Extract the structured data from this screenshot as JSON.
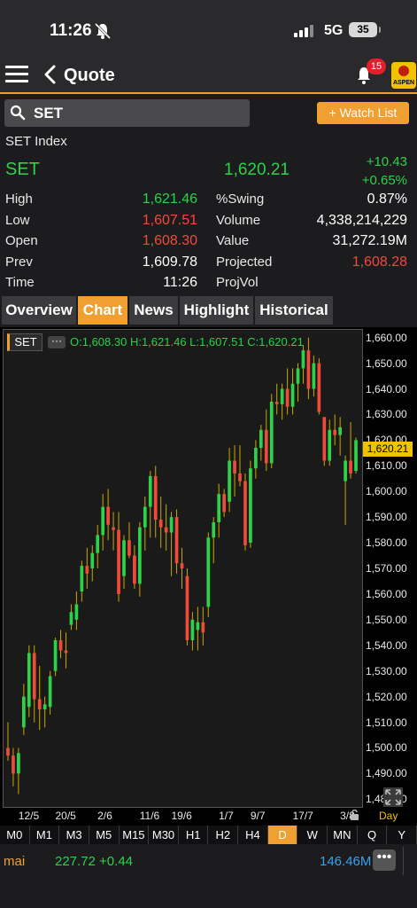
{
  "status_bar": {
    "time": "11:26",
    "network": "5G",
    "battery": "35"
  },
  "nav": {
    "title": "Quote",
    "notification_count": "15",
    "logo_text": "ASPEN"
  },
  "search": {
    "query": "SET",
    "watch_list_label": "+ Watch List"
  },
  "quote": {
    "index_name": "SET Index",
    "symbol": "SET",
    "last": "1,620.21",
    "change": "+10.43",
    "change_pct": "+0.65%",
    "stats_left": [
      {
        "label": "High",
        "value": "1,621.46",
        "color": "#2bd24a"
      },
      {
        "label": "Low",
        "value": "1,607.51",
        "color": "#f04a3a"
      },
      {
        "label": "Open",
        "value": "1,608.30",
        "color": "#f04a3a"
      },
      {
        "label": "Prev",
        "value": "1,609.78",
        "color": "#ffffff"
      },
      {
        "label": "Time",
        "value": "11:26",
        "color": "#ffffff"
      }
    ],
    "stats_right": [
      {
        "label": "%Swing",
        "value": "0.87%",
        "color": "#ffffff"
      },
      {
        "label": "Volume",
        "value": "4,338,214,229",
        "color": "#ffffff"
      },
      {
        "label": "Value",
        "value": "31,272.19M",
        "color": "#ffffff"
      },
      {
        "label": "Projected",
        "value": "1,608.28",
        "color": "#f04a3a"
      },
      {
        "label": "ProjVol",
        "value": "",
        "color": "#ffffff"
      }
    ]
  },
  "tabs": [
    "Overview",
    "Chart",
    "News",
    "Highlight",
    "Historical"
  ],
  "active_tab": "Chart",
  "chart": {
    "symbol_chip": "SET",
    "ohlc_text": "O:1,608.30  H:1,621.46  L:1,607.51  C:1,620.21",
    "current_price_tag": "1,620.21",
    "period_label": "Day"
  },
  "chart_data": {
    "type": "candlestick",
    "ylim": [
      1477,
      1663
    ],
    "yticks": [
      1660,
      1650,
      1640,
      1630,
      1620,
      1610,
      1600,
      1590,
      1580,
      1570,
      1560,
      1550,
      1540,
      1530,
      1520,
      1510,
      1500,
      1490,
      1480
    ],
    "ytick_labels": [
      "1,660.00",
      "1,650.00",
      "1,640.00",
      "1,630.00",
      "1,620.00",
      "1,610.00",
      "1,600.00",
      "1,590.00",
      "1,580.00",
      "1,570.00",
      "1,560.00",
      "1,550.00",
      "1,540.00",
      "1,530.00",
      "1,520.00",
      "1,510.00",
      "1,500.00",
      "1,490.00",
      "1,480.00"
    ],
    "xtick_labels": [
      {
        "label": "12/5",
        "index": 4
      },
      {
        "label": "20/5",
        "index": 11
      },
      {
        "label": "2/6",
        "index": 19
      },
      {
        "label": "11/6",
        "index": 27
      },
      {
        "label": "19/6",
        "index": 33
      },
      {
        "label": "1/7",
        "index": 42
      },
      {
        "label": "9/7",
        "index": 48
      },
      {
        "label": "17/7",
        "index": 56
      },
      {
        "label": "3/8",
        "index": 65
      }
    ],
    "candles": [
      [
        1500,
        1510,
        1495,
        1497
      ],
      [
        1497,
        1500,
        1485,
        1490
      ],
      [
        1490,
        1500,
        1482,
        1498
      ],
      [
        1508,
        1525,
        1505,
        1520
      ],
      [
        1516,
        1540,
        1512,
        1537
      ],
      [
        1537,
        1540,
        1510,
        1519
      ],
      [
        1519,
        1532,
        1507,
        1515
      ],
      [
        1515,
        1520,
        1508,
        1517
      ],
      [
        1516,
        1530,
        1513,
        1528
      ],
      [
        1530,
        1543,
        1528,
        1542
      ],
      [
        1542,
        1546,
        1535,
        1538
      ],
      [
        1538,
        1545,
        1531,
        1537
      ],
      [
        1548,
        1556,
        1546,
        1553
      ],
      [
        1550,
        1561,
        1546,
        1556
      ],
      [
        1561,
        1573,
        1557,
        1571
      ],
      [
        1571,
        1578,
        1562,
        1568
      ],
      [
        1570,
        1579,
        1565,
        1576
      ],
      [
        1576,
        1587,
        1570,
        1583
      ],
      [
        1583,
        1599,
        1577,
        1594
      ],
      [
        1594,
        1601,
        1581,
        1587
      ],
      [
        1586,
        1592,
        1577,
        1585
      ],
      [
        1585,
        1592,
        1557,
        1560
      ],
      [
        1567,
        1583,
        1562,
        1581
      ],
      [
        1581,
        1588,
        1574,
        1575
      ],
      [
        1575,
        1579,
        1562,
        1564
      ],
      [
        1564,
        1588,
        1559,
        1586
      ],
      [
        1586,
        1598,
        1577,
        1594
      ],
      [
        1594,
        1608,
        1582,
        1606
      ],
      [
        1606,
        1610,
        1582,
        1589
      ],
      [
        1589,
        1598,
        1578,
        1586
      ],
      [
        1586,
        1595,
        1577,
        1584
      ],
      [
        1584,
        1592,
        1567,
        1590
      ],
      [
        1590,
        1593,
        1568,
        1572
      ],
      [
        1572,
        1578,
        1562,
        1570
      ],
      [
        1567,
        1570,
        1540,
        1542
      ],
      [
        1542,
        1553,
        1538,
        1550
      ],
      [
        1546,
        1555,
        1538,
        1549
      ],
      [
        1549,
        1555,
        1540,
        1545
      ],
      [
        1555,
        1584,
        1551,
        1582
      ],
      [
        1582,
        1590,
        1572,
        1588
      ],
      [
        1588,
        1603,
        1582,
        1599
      ],
      [
        1599,
        1601,
        1590,
        1592
      ],
      [
        1596,
        1617,
        1592,
        1612
      ],
      [
        1612,
        1618,
        1598,
        1607
      ],
      [
        1607,
        1618,
        1602,
        1604
      ],
      [
        1604,
        1607,
        1577,
        1579
      ],
      [
        1580,
        1612,
        1578,
        1609
      ],
      [
        1609,
        1620,
        1605,
        1617
      ],
      [
        1617,
        1626,
        1612,
        1624
      ],
      [
        1624,
        1632,
        1608,
        1611
      ],
      [
        1611,
        1638,
        1609,
        1635
      ],
      [
        1635,
        1642,
        1630,
        1634
      ],
      [
        1634,
        1642,
        1628,
        1640
      ],
      [
        1640,
        1648,
        1630,
        1633
      ],
      [
        1633,
        1648,
        1630,
        1642
      ],
      [
        1642,
        1650,
        1635,
        1648
      ],
      [
        1648,
        1657,
        1642,
        1655
      ],
      [
        1655,
        1660,
        1636,
        1640
      ],
      [
        1640,
        1653,
        1637,
        1650
      ],
      [
        1650,
        1652,
        1630,
        1631
      ],
      [
        1629,
        1629,
        1610,
        1612
      ],
      [
        1612,
        1628,
        1610,
        1624
      ],
      [
        1624,
        1630,
        1618,
        1622
      ],
      [
        1622,
        1629,
        1614,
        1625
      ],
      [
        1604,
        1614,
        1587,
        1612
      ],
      [
        1612,
        1627,
        1605,
        1607
      ],
      [
        1608,
        1621,
        1607,
        1620
      ]
    ]
  },
  "periods": [
    "M0",
    "M1",
    "M3",
    "M5",
    "M15",
    "M30",
    "H1",
    "H2",
    "H4",
    "D",
    "W",
    "MN",
    "Q",
    "Y"
  ],
  "active_period": "D",
  "bottom": {
    "name": "mai",
    "value_change": "227.72 +0.44",
    "volume": "146.46M",
    "more_label": "•••"
  }
}
